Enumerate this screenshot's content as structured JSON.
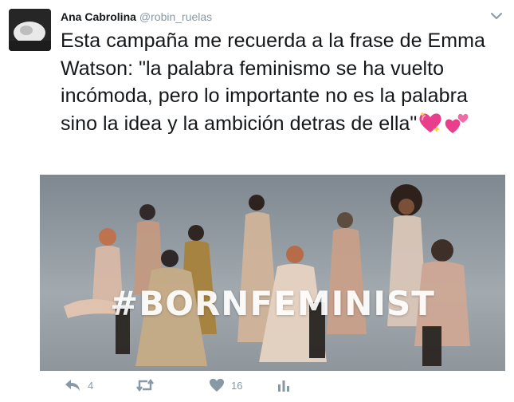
{
  "tweet": {
    "author_name": "Ana Cabrolina",
    "author_handle": "@robin_ruelas",
    "text": "Esta campaña me recuerda a la frase de Emma Watson: \"la palabra feminismo se ha vuelto incómoda, pero lo importante no es la palabra sino la idea y la ambición detras de ella\"",
    "emojis": [
      "sparkling-heart-icon",
      "two-hearts-icon"
    ],
    "media": {
      "overlay_text": "#BORNFEMINIST"
    },
    "actions": {
      "reply_count": "4",
      "retweet_count": "",
      "like_count": "16"
    }
  },
  "colors": {
    "text": "#14171a",
    "muted": "#8899a6",
    "emoji_pink": "#e83e8c"
  }
}
